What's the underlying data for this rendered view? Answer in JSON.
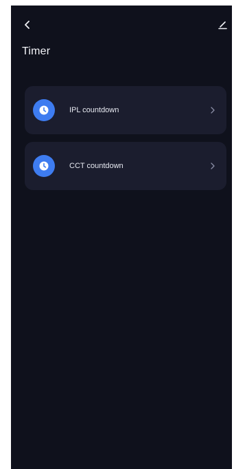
{
  "header": {
    "title": "Timer",
    "back_icon": "chevron-left-icon",
    "edit_icon": "pencil-icon"
  },
  "timers": [
    {
      "label": "IPL countdown",
      "icon": "clock-icon"
    },
    {
      "label": "CCT countdown",
      "icon": "clock-icon"
    }
  ],
  "colors": {
    "background": "#0f111c",
    "card": "#1b1d2e",
    "accent": "#3e7cf0",
    "text": "#f2f3f7"
  }
}
